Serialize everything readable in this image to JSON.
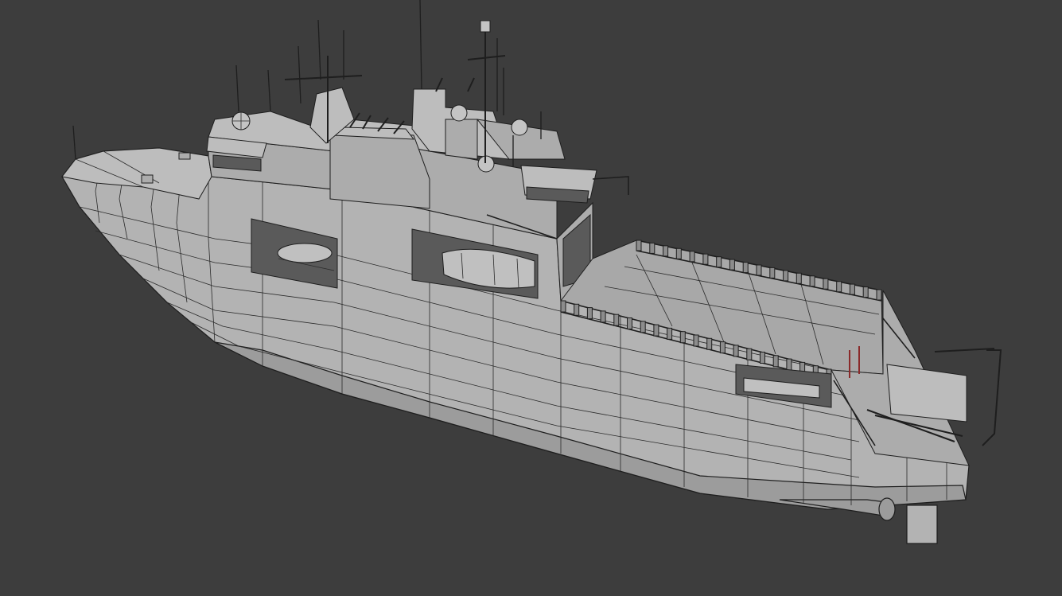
{
  "viewport": {
    "background_color": "#3d3d3d",
    "object_color": "#b3b3b3",
    "wireframe_color": "#1e1e1e"
  }
}
